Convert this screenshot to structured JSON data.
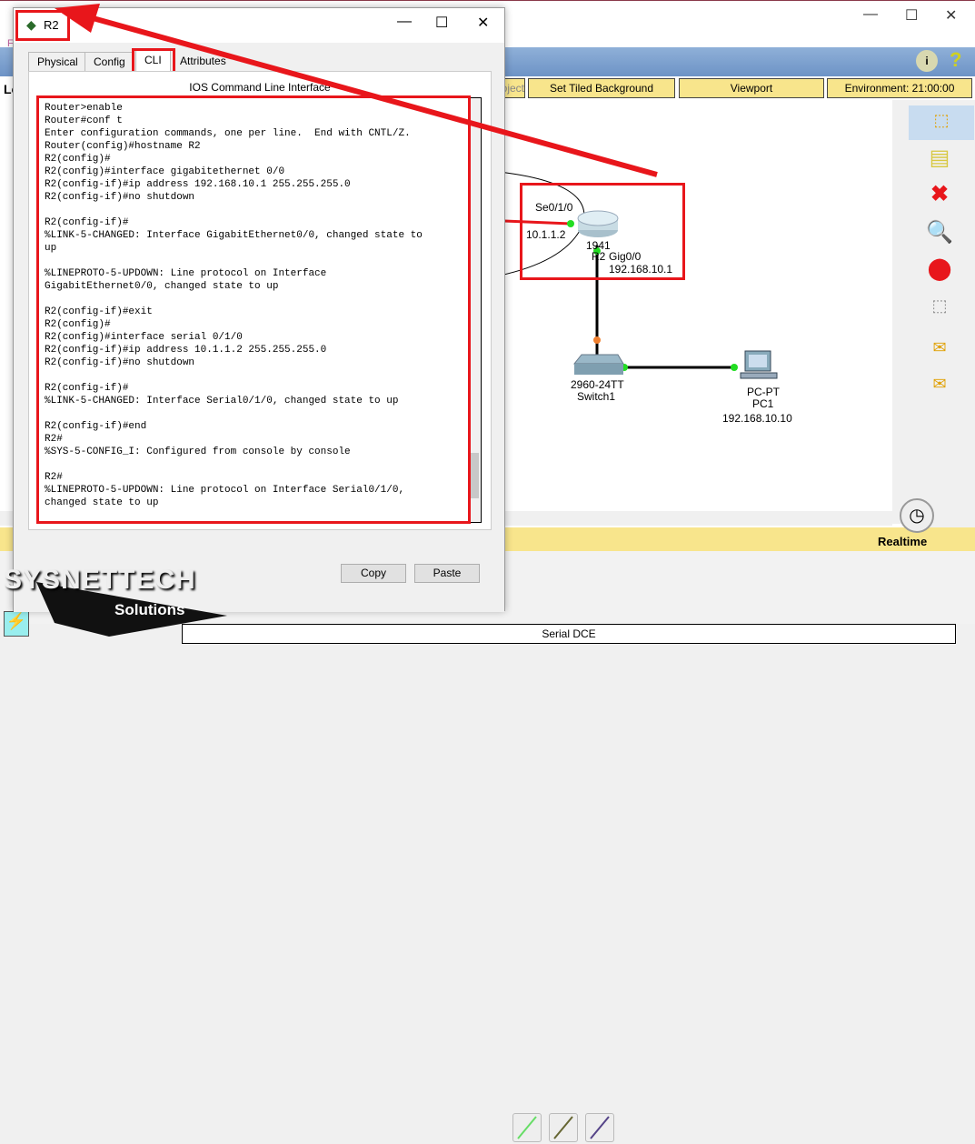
{
  "app": {
    "menu_first_letter": "F",
    "left_label": "Lo",
    "toolbar_buttons": [
      "Set Tiled Background",
      "Viewport",
      "Environment: 21:00:00"
    ],
    "partial_button": "oject",
    "mode": "Realtime",
    "connection_type": "Serial DCE"
  },
  "dialog": {
    "title": "R2",
    "tabs": [
      "Physical",
      "Config",
      "CLI",
      "Attributes"
    ],
    "active_tab": "CLI",
    "heading": "IOS Command Line Interface",
    "copy_label": "Copy",
    "paste_label": "Paste",
    "cli_lines": [
      "Router>enable",
      "Router#conf t",
      "Enter configuration commands, one per line.  End with CNTL/Z.",
      "Router(config)#hostname R2",
      "R2(config)#",
      "R2(config)#interface gigabitethernet 0/0",
      "R2(config-if)#ip address 192.168.10.1 255.255.255.0",
      "R2(config-if)#no shutdown",
      "",
      "R2(config-if)#",
      "%LINK-5-CHANGED: Interface GigabitEthernet0/0, changed state to",
      "up",
      "",
      "%LINEPROTO-5-UPDOWN: Line protocol on Interface",
      "GigabitEthernet0/0, changed state to up",
      "",
      "R2(config-if)#exit",
      "R2(config)#",
      "R2(config)#interface serial 0/1/0",
      "R2(config-if)#ip address 10.1.1.2 255.255.255.0",
      "R2(config-if)#no shutdown",
      "",
      "R2(config-if)#",
      "%LINK-5-CHANGED: Interface Serial0/1/0, changed state to up",
      "",
      "R2(config-if)#end",
      "R2#",
      "%SYS-5-CONFIG_I: Configured from console by console",
      "",
      "R2#",
      "%LINEPROTO-5-UPDOWN: Line protocol on Interface Serial0/1/0,",
      "changed state to up",
      ""
    ]
  },
  "topology": {
    "router": {
      "model": "1941",
      "name": "R2",
      "serial_port": "Se0/1/0",
      "serial_ip": "10.1.1.2",
      "gig_port": "Gig0/0",
      "gig_ip": "192.168.10.1"
    },
    "switch": {
      "model": "2960-24TT",
      "name": "Switch1"
    },
    "pc": {
      "model": "PC-PT",
      "name": "PC1",
      "ip": "192.168.10.10"
    }
  },
  "watermark": {
    "brand": "SYSNETTECH",
    "tagline": "Solutions"
  },
  "colors": {
    "highlight": "#e8161b",
    "link_up": "#22dd22",
    "toolbar_yellow": "#f8e58c"
  }
}
